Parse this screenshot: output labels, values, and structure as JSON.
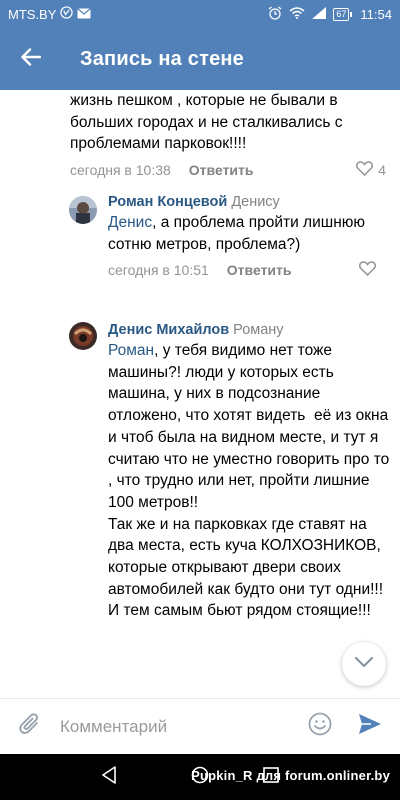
{
  "status_bar": {
    "carrier": "MTS.BY",
    "battery": "67",
    "time": "11:54"
  },
  "header": {
    "title": "Запись на стене"
  },
  "comments": [
    {
      "text": "жизнь пешком , которые не бывали в больших городах и не сталкивались с проблемами парковок!!!!",
      "time": "сегодня в 10:38",
      "reply_label": "Ответить",
      "likes": "4"
    },
    {
      "author": "Роман Концевой",
      "reply_to": "Денису",
      "mention": "Денис",
      "text": ", а проблема пройти лишнюю сотню метров, проблема?)",
      "time": "сегодня в 10:51",
      "reply_label": "Ответить"
    },
    {
      "author": "Денис Михайлов",
      "reply_to": "Роману",
      "mention": "Роман",
      "text": ", у тебя видимо нет тоже машины?! люди у которых есть машина, у них в подсознание отложено, что хотят видеть  её из окна и чтоб была на видном месте, и тут я считаю что не уместно говорить про то , что трудно или нет, пройти лишние 100 метров!!\nТак же и на парковках где ставят на два места, есть куча КОЛХОЗНИКОВ, которые открывают двери своих автомобилей как будто они тут одни!!! И тем самым бьют рядом стоящие!!!"
    }
  ],
  "composer": {
    "placeholder": "Комментарий"
  },
  "watermark": "Pupkin_R для forum.onliner.by",
  "colors": {
    "brand": "#5181b8",
    "link": "#2a5885",
    "meta": "#939393"
  },
  "icons": [
    "back-arrow-icon",
    "heart-icon",
    "chevron-down-icon",
    "paperclip-icon",
    "smiley-icon",
    "send-icon",
    "nav-back-icon",
    "nav-home-icon",
    "nav-recents-icon"
  ]
}
